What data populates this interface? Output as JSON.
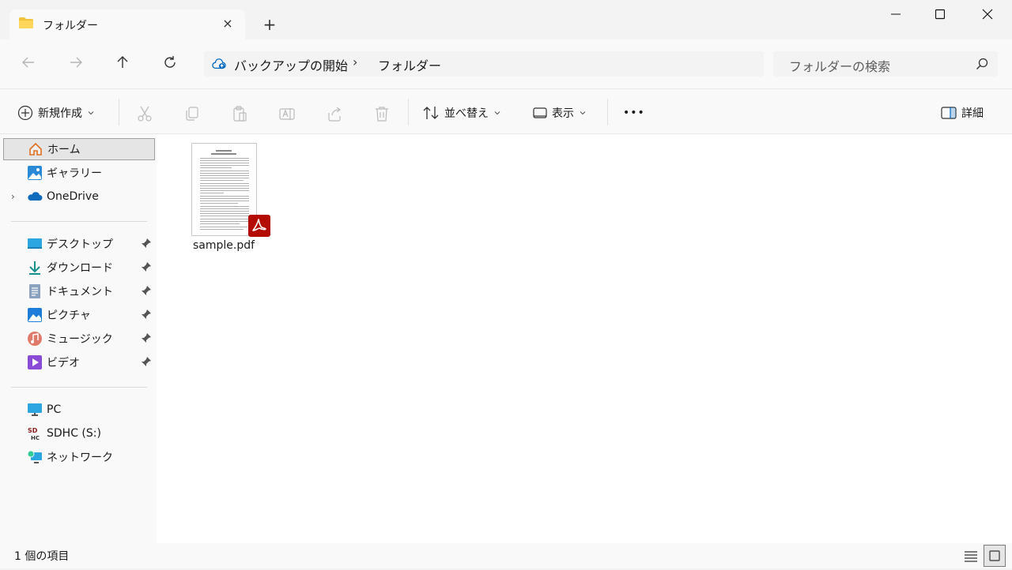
{
  "tab": {
    "title": "フォルダー",
    "close_label": "×",
    "new_tab_label": "+"
  },
  "window": {
    "minimize": "—",
    "maximize": "☐",
    "close": "✕"
  },
  "address": {
    "breadcrumbs": [
      "バックアップの開始",
      "フォルダー"
    ],
    "separator": "›",
    "search_placeholder": "フォルダーの検索"
  },
  "toolbar": {
    "new_label": "新規作成",
    "sort_label": "並べ替え",
    "view_label": "表示",
    "more_label": "•••",
    "details_label": "詳細"
  },
  "sidebar": {
    "home": "ホーム",
    "gallery": "ギャラリー",
    "onedrive": "OneDrive",
    "quick": [
      "デスクトップ",
      "ダウンロード",
      "ドキュメント",
      "ピクチャ",
      "ミュージック",
      "ビデオ"
    ],
    "devices": [
      "PC",
      "SDHC (S:)",
      "ネットワーク"
    ]
  },
  "files": [
    {
      "name": "sample.pdf",
      "type": "pdf"
    }
  ],
  "status": {
    "item_count": "1 個の項目"
  },
  "colors": {
    "accent": "#0067c0",
    "pdf_red": "#b30b00",
    "folder_yellow": "#f3c23b"
  }
}
